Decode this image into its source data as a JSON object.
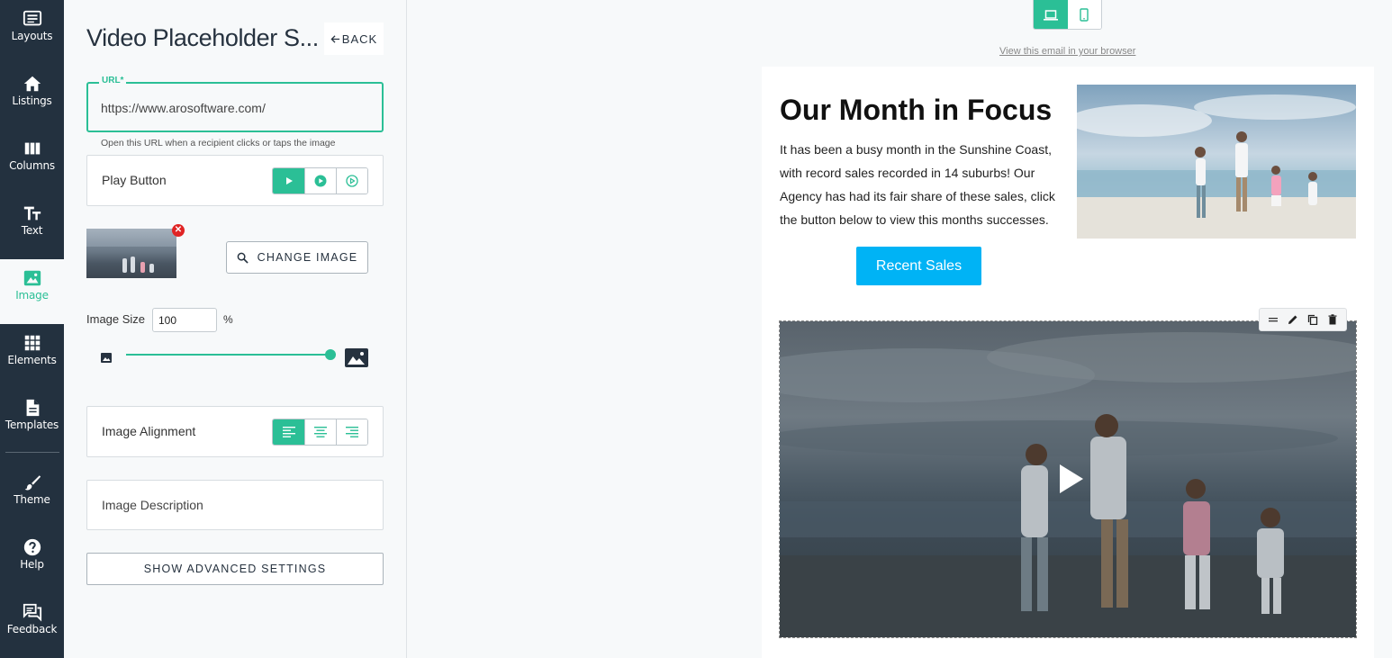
{
  "nav": {
    "items": [
      {
        "label": "Layouts",
        "icon": "layouts-icon"
      },
      {
        "label": "Listings",
        "icon": "home-icon"
      },
      {
        "label": "Columns",
        "icon": "columns-icon"
      },
      {
        "label": "Text",
        "icon": "text-icon"
      },
      {
        "label": "Image",
        "icon": "image-icon",
        "active": true
      },
      {
        "label": "Elements",
        "icon": "grid-icon"
      },
      {
        "label": "Templates",
        "icon": "document-icon"
      },
      {
        "label": "Theme",
        "icon": "brush-icon"
      },
      {
        "label": "Help",
        "icon": "help-icon"
      },
      {
        "label": "Feedback",
        "icon": "feedback-icon"
      }
    ]
  },
  "panel": {
    "title": "Video Placeholder S...",
    "back_label": "BACK",
    "url": {
      "label": "URL*",
      "value": "https://www.arosoftware.com/",
      "help": "Open this URL when a recipient clicks or taps the image"
    },
    "play_button": {
      "label": "Play Button",
      "options": [
        "play-triangle-icon",
        "play-circle-filled-icon",
        "play-circle-outline-icon"
      ],
      "selected": 0
    },
    "change_image_label": "CHANGE IMAGE",
    "image_size": {
      "label": "Image Size",
      "value": "100",
      "unit": "%",
      "slider_percent": 100
    },
    "alignment": {
      "label": "Image Alignment",
      "options": [
        "align-left-icon",
        "align-center-icon",
        "align-right-icon"
      ],
      "selected": 0
    },
    "image_description": {
      "label": "Image Description"
    },
    "advanced_label": "SHOW ADVANCED SETTINGS"
  },
  "preview": {
    "device": {
      "selected": "desktop"
    },
    "view_in_browser": "View this email in your browser",
    "heading": "Our Month in Focus",
    "body": "It has been a busy month in the Sunshine Coast, with record sales recorded in 14 suburbs! Our Agency has had its fair share of these sales, click the button below to view this months successes.",
    "cta_label": "Recent Sales",
    "colors": {
      "accent": "#2bbf96",
      "cta": "#00b3f5",
      "nav_bg": "#23313f"
    }
  }
}
